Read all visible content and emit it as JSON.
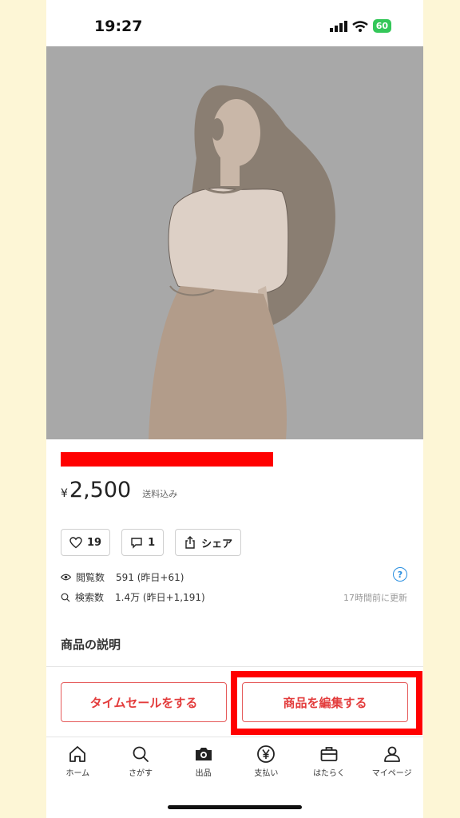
{
  "status_bar": {
    "time": "19:27",
    "battery": "60"
  },
  "product": {
    "currency": "¥",
    "price": "2,500",
    "shipping": "送料込み"
  },
  "actions": {
    "likes": "19",
    "comments": "1",
    "share": "シェア"
  },
  "stats": {
    "views_label": "閲覧数",
    "views_value": "591 (昨日+61)",
    "search_label": "検索数",
    "search_value": "1.4万 (昨日+1,191)",
    "help": "?",
    "updated": "17時間前に更新"
  },
  "description_title": "商品の説明",
  "buttons": {
    "time_sale": "タイムセールをする",
    "edit_item": "商品を編集する"
  },
  "tabs": [
    {
      "label": "ホーム",
      "icon": "home-icon"
    },
    {
      "label": "さがす",
      "icon": "search-icon"
    },
    {
      "label": "出品",
      "icon": "camera-icon"
    },
    {
      "label": "支払い",
      "icon": "yen-icon"
    },
    {
      "label": "はたらく",
      "icon": "briefcase-icon"
    },
    {
      "label": "マイページ",
      "icon": "person-icon"
    }
  ],
  "colors": {
    "accent": "#e33c3c",
    "highlight": "#ff0000",
    "background": "#fdf6d6",
    "battery": "#34c759",
    "help": "#2a8fe0"
  }
}
